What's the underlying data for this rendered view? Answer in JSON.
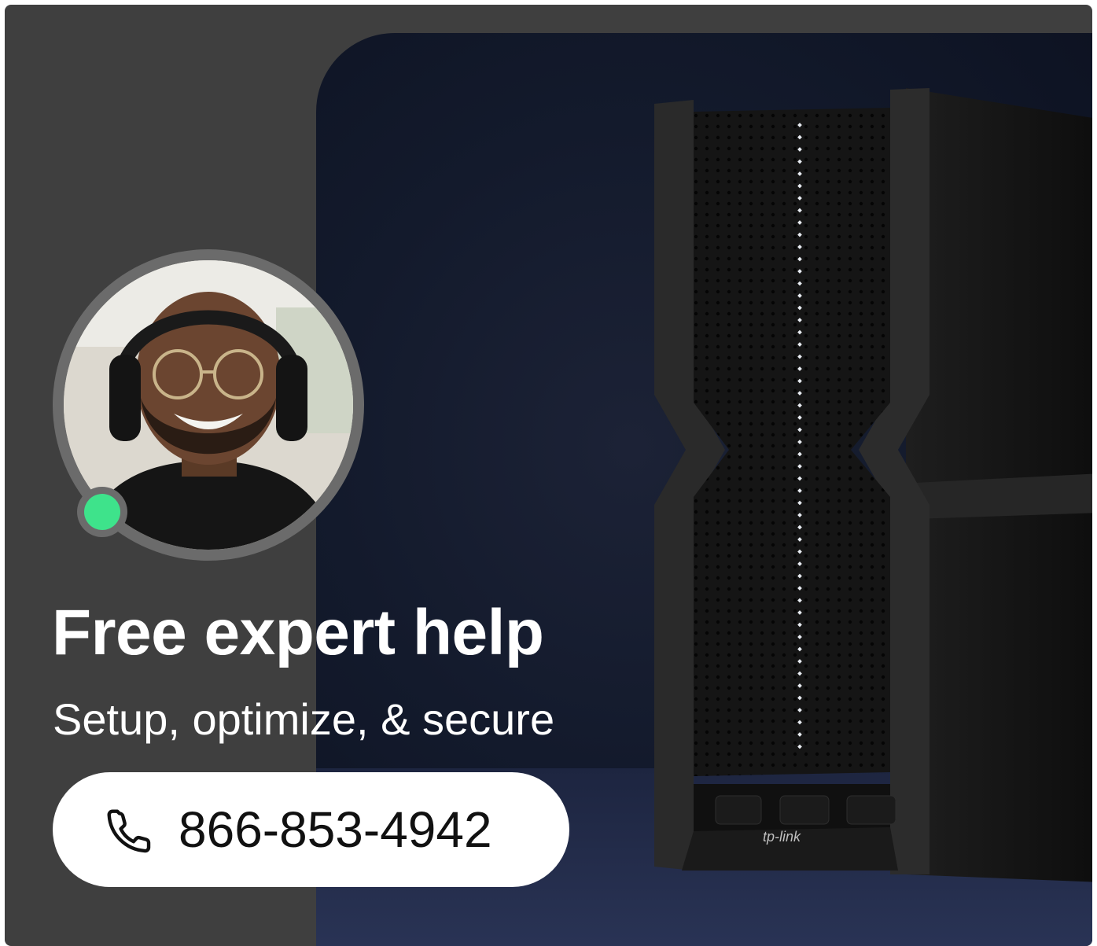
{
  "ad": {
    "headline": "Free expert help",
    "subheadline": "Setup, optimize, & secure",
    "phone_number": "866-853-4942",
    "product_brand_mark": "tp-link"
  },
  "colors": {
    "card_background": "#3f3f3f",
    "status_online": "#3ee38b",
    "pill_background": "#ffffff",
    "text_light": "#ffffff",
    "text_dark": "#111111"
  },
  "icons": {
    "phone": "phone-icon",
    "status": "online-status-dot"
  }
}
